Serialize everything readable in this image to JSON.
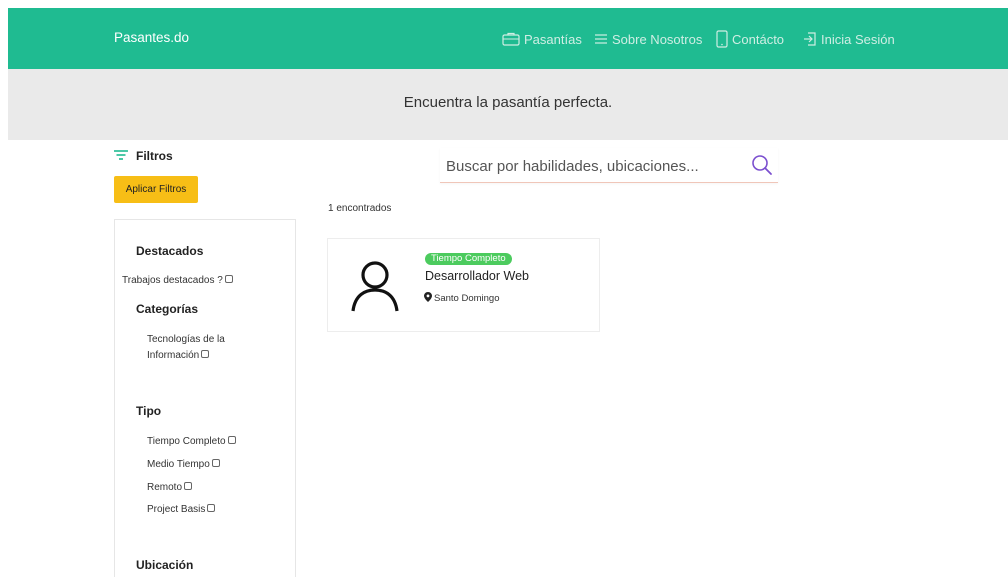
{
  "navbar": {
    "brand": "Pasantes.do",
    "items": [
      {
        "label": "Pasantías",
        "icon": "briefcase-icon"
      },
      {
        "label": "Sobre Nosotros",
        "icon": "menu-lines-icon"
      },
      {
        "label": "Contácto",
        "icon": "phone-icon"
      },
      {
        "label": "Inicia Sesión",
        "icon": "sign-in-icon"
      }
    ],
    "bg_color": "#1fbb91"
  },
  "hero": {
    "text": "Encuentra la pasantía perfecta."
  },
  "filters": {
    "label": "Filtros",
    "apply_label": "Aplicar Filtros",
    "sections": {
      "featured": {
        "title": "Destacados",
        "options": [
          "Trabajos destacados ?"
        ]
      },
      "categories": {
        "title": "Categorías",
        "options": [
          "Tecnologías de la Información"
        ]
      },
      "type": {
        "title": "Tipo",
        "options": [
          "Tiempo Completo",
          "Medio Tiempo",
          "Remoto",
          "Project Basis"
        ]
      },
      "location": {
        "title": "Ubicación"
      }
    }
  },
  "search": {
    "placeholder": "Buscar por habilidades, ubicaciones..."
  },
  "results": {
    "count_text": "1 encontrados",
    "jobs": [
      {
        "badge": "Tiempo Completo",
        "title": "Desarrollador Web",
        "location": "Santo Domingo"
      }
    ]
  },
  "colors": {
    "accent": "#1fbb91",
    "button": "#f7be16",
    "badge": "#4ccb5e",
    "search_icon": "#7b4fcf"
  }
}
